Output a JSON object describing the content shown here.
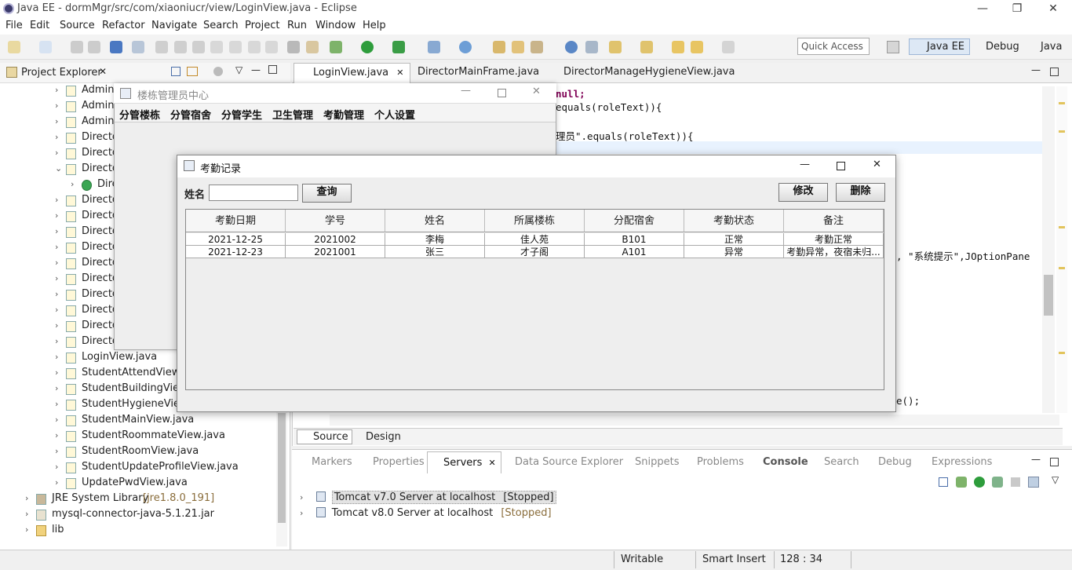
{
  "eclipse": {
    "window_title": "Java EE - dormMgr/src/com/xiaoniucr/view/LoginView.java - Eclipse",
    "menu": [
      "File",
      "Edit",
      "Source",
      "Refactor",
      "Navigate",
      "Search",
      "Project",
      "Run",
      "Window",
      "Help"
    ],
    "quick_access": "Quick Access",
    "perspectives": [
      "Java EE",
      "Debug",
      "Java"
    ],
    "project_explorer": {
      "title": "Project Explorer",
      "items": [
        {
          "label": "AdminU",
          "arrow": "›",
          "icon": "java-file-icon"
        },
        {
          "label": "AdminU",
          "arrow": "›",
          "icon": "java-file-icon"
        },
        {
          "label": "AdminU",
          "arrow": "›",
          "icon": "java-file-icon"
        },
        {
          "label": "Directo",
          "arrow": "›",
          "icon": "java-file-icon"
        },
        {
          "label": "Directo",
          "arrow": "›",
          "icon": "java-file-icon"
        },
        {
          "label": "Directo",
          "arrow": "⌄",
          "icon": "java-file-icon"
        },
        {
          "label": "Dire",
          "arrow": "›",
          "icon": "class-icon"
        },
        {
          "label": "Directo",
          "arrow": "›",
          "icon": "java-file-icon"
        },
        {
          "label": "Directo",
          "arrow": "›",
          "icon": "java-file-icon"
        },
        {
          "label": "Directo",
          "arrow": "›",
          "icon": "java-file-icon"
        },
        {
          "label": "Directo",
          "arrow": "›",
          "icon": "java-file-icon"
        },
        {
          "label": "Directo",
          "arrow": "›",
          "icon": "java-file-icon"
        },
        {
          "label": "Directo",
          "arrow": "›",
          "icon": "java-file-icon"
        },
        {
          "label": "Directo",
          "arrow": "›",
          "icon": "java-file-icon"
        },
        {
          "label": "Directo",
          "arrow": "›",
          "icon": "java-file-icon"
        },
        {
          "label": "Directo",
          "arrow": "›",
          "icon": "java-file-icon"
        },
        {
          "label": "Directo",
          "arrow": "›",
          "icon": "java-file-icon"
        },
        {
          "label": "LoginView.java",
          "arrow": "›",
          "icon": "java-file-icon"
        },
        {
          "label": "StudentAttendView.ja",
          "arrow": "›",
          "icon": "java-file-icon"
        },
        {
          "label": "StudentBuildingView.",
          "arrow": "›",
          "icon": "java-file-icon"
        },
        {
          "label": "StudentHygieneView.",
          "arrow": "›",
          "icon": "java-file-icon"
        },
        {
          "label": "StudentMainView.java",
          "arrow": "›",
          "icon": "java-file-icon"
        },
        {
          "label": "StudentRoommateView.java",
          "arrow": "›",
          "icon": "java-file-icon"
        },
        {
          "label": "StudentRoomView.java",
          "arrow": "›",
          "icon": "java-file-icon"
        },
        {
          "label": "StudentUpdateProfileView.java",
          "arrow": "›",
          "icon": "java-file-icon"
        },
        {
          "label": "UpdatePwdView.java",
          "arrow": "›",
          "icon": "java-file-icon"
        },
        {
          "label": "JRE System Library",
          "extra": "[jre1.8.0_191]",
          "arrow": "›",
          "icon": "library-icon"
        },
        {
          "label": "mysql-connector-java-5.1.21.jar",
          "arrow": "›",
          "icon": "jar-icon"
        },
        {
          "label": "lib",
          "arrow": "›",
          "icon": "folder-icon"
        }
      ]
    },
    "editor_tabs": [
      "LoginView.java",
      "DirectorMainFrame.java",
      "DirectorManageHygieneView.java"
    ],
    "code_fragments": {
      "line1": "null;",
      "line2": "equals(roleText)){",
      "line3": "理员\".equals(roleText)){",
      "line4": ", \"系统提示\",JOptionPane",
      "line5": "e();"
    },
    "editor_bottom_tabs": [
      "Source",
      "Design"
    ],
    "bottom_tabs": [
      "Markers",
      "Properties",
      "Servers",
      "Data Source Explorer",
      "Snippets",
      "Problems",
      "Console",
      "Search",
      "Debug",
      "Expressions"
    ],
    "servers": [
      {
        "name": "Tomcat v7.0 Server at localhost",
        "state": "[Stopped]"
      },
      {
        "name": "Tomcat v8.0 Server at localhost",
        "state": "[Stopped]"
      }
    ],
    "status": {
      "writable": "Writable",
      "insert": "Smart Insert",
      "position": "128 : 34"
    }
  },
  "dorm_window": {
    "title": "楼栋管理员中心",
    "menu": [
      "分管楼栋",
      "分管宿舍",
      "分管学生",
      "卫生管理",
      "考勤管理",
      "个人设置"
    ]
  },
  "attendance_window": {
    "title": "考勤记录",
    "name_label": "姓名",
    "name_value": "",
    "query_button": "查询",
    "edit_button": "修改",
    "delete_button": "删除",
    "columns": [
      "考勤日期",
      "学号",
      "姓名",
      "所属楼栋",
      "分配宿舍",
      "考勤状态",
      "备注"
    ],
    "rows": [
      [
        "2021-12-25",
        "2021002",
        "李梅",
        "佳人苑",
        "B101",
        "正常",
        "考勤正常"
      ],
      [
        "2021-12-23",
        "2021001",
        "张三",
        "才子阁",
        "A101",
        "异常",
        "考勤异常，夜宿未归..."
      ]
    ]
  }
}
